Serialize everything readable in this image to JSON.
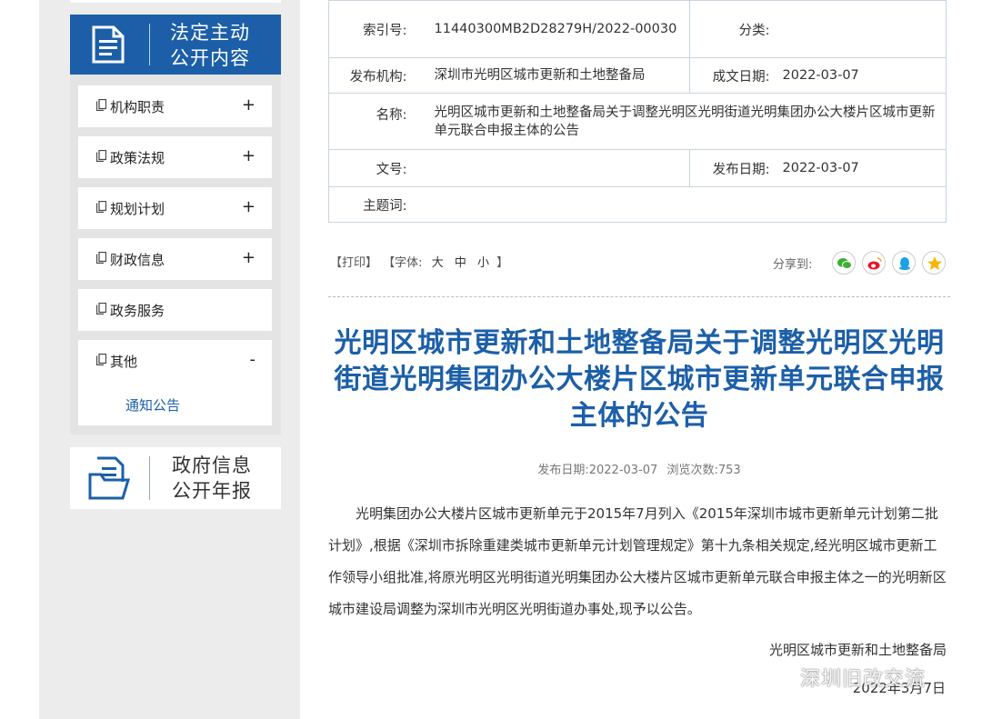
{
  "sidebar": {
    "main_banner": {
      "line1": "法定主动",
      "line2": "公开内容"
    },
    "items": [
      {
        "label": "机构职责",
        "toggle": "+"
      },
      {
        "label": "政策法规",
        "toggle": "+"
      },
      {
        "label": "规划计划",
        "toggle": "+"
      },
      {
        "label": "财政信息",
        "toggle": "+"
      },
      {
        "label": "政务服务",
        "toggle": ""
      },
      {
        "label": "其他",
        "toggle": "-",
        "children": [
          {
            "label": "通知公告"
          }
        ]
      }
    ],
    "annual_banner": {
      "line1": "政府信息",
      "line2": "公开年报"
    }
  },
  "info": {
    "index_label": "索引号:",
    "index_value": "11440300MB2D28279H/2022-00030",
    "category_label": "分类:",
    "category_value": "",
    "publisher_label": "发布机构:",
    "publisher_value": "深圳市光明区城市更新和土地整备局",
    "created_label": "成文日期:",
    "created_value": "2022-03-07",
    "name_label": "名称:",
    "name_value": "光明区城市更新和土地整备局关于调整光明区光明街道光明集团办公大楼片区城市更新单元联合申报主体的公告",
    "docno_label": "文号:",
    "docno_value": "",
    "pubdate_label": "发布日期:",
    "pubdate_value": "2022-03-07",
    "keywords_label": "主题词:",
    "keywords_value": ""
  },
  "toolbar": {
    "print": "【打印】",
    "font_prefix": "【字体:",
    "font_large": "大",
    "font_medium": "中",
    "font_small": "小",
    "font_suffix": "】",
    "share_label": "分享到:"
  },
  "share_icons": [
    "wechat-icon",
    "weibo-icon",
    "qq-icon",
    "qzone-icon"
  ],
  "article": {
    "title": "光明区城市更新和土地整备局关于调整光明区光明街道光明集团办公大楼片区城市更新单元联合申报主体的公告",
    "meta_date": "发布日期:2022-03-07",
    "meta_views": "浏览次数:753",
    "body": "光明集团办公大楼片区城市更新单元于2015年7月列入《2015年深圳市城市更新单元计划第二批计划》,根据《深圳市拆除重建类城市更新单元计划管理规定》第十九条相关规定,经光明区城市更新工作领导小组批准,将原光明区光明街道光明集团办公大楼片区城市更新单元联合申报主体之一的光明新区城市建设局调整为深圳市光明区光明街道办事处,现予以公告。",
    "sign_org": "光明区城市更新和土地整备局",
    "sign_date": "2022年3月7日"
  },
  "watermark": {
    "text": "深圳旧改交流"
  },
  "colors": {
    "brand_blue": "#1c5fa8",
    "sidebar_bg": "#ececec"
  }
}
